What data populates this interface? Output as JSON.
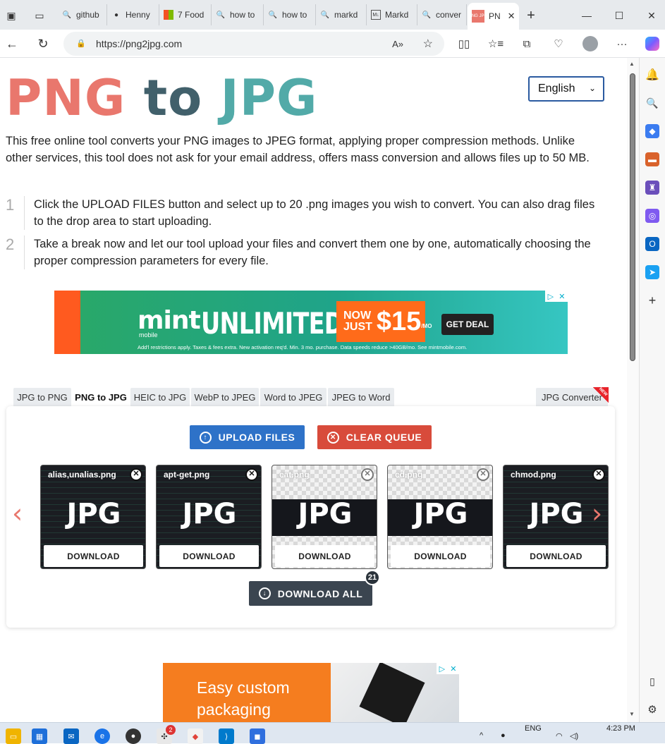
{
  "browser": {
    "tabs": [
      {
        "label": "github",
        "icon": "search-icon"
      },
      {
        "label": "Henny",
        "icon": "github-icon"
      },
      {
        "label": "7 Food",
        "icon": "microsoft-icon"
      },
      {
        "label": "how to",
        "icon": "search-icon"
      },
      {
        "label": "how to",
        "icon": "search-icon"
      },
      {
        "label": "markd",
        "icon": "search-icon"
      },
      {
        "label": "Markd",
        "icon": "markdown-icon"
      },
      {
        "label": "conver",
        "icon": "search-icon"
      },
      {
        "label": "PN",
        "icon": "png2jpg-favicon",
        "active": true
      }
    ],
    "active_tab_favicon_text": "PNG JPG",
    "url": "https://png2jpg.com",
    "colors": {
      "tabbar": "#e7eaed",
      "accent": "#1a73e8"
    }
  },
  "page": {
    "logo": {
      "part1": "PNG",
      "part2": "to",
      "part3": "JPG"
    },
    "language": "English",
    "intro": "This free online tool converts your PNG images to JPEG format, applying proper compression methods. Unlike other services, this tool does not ask for your email address, offers mass conversion and allows files up to 50 MB.",
    "steps": [
      {
        "num": "1",
        "text": "Click the UPLOAD FILES button and select up to 20 .png images you wish to convert. You can also drag files to the drop area to start uploading."
      },
      {
        "num": "2",
        "text": "Take a break now and let our tool upload your files and convert them one by one, automatically choosing the proper compression parameters for every file."
      }
    ],
    "ad1": {
      "brand": "mint",
      "brand_sub": "mobile",
      "headline": "UNLIMITED",
      "price_lead1": "NOW",
      "price_lead2": "JUST",
      "price": "$15",
      "price_suffix": "/MO",
      "cta": "GET DEAL",
      "fine_print": "Add'l restrictions apply. Taxes & fees extra. New activation req'd. Min. 3 mo. purchase. Data speeds reduce >40GB/mo. See mintmobile.com."
    },
    "converter_tabs": [
      {
        "label": "JPG to PNG"
      },
      {
        "label": "PNG to JPG",
        "active": true
      },
      {
        "label": "HEIC to JPG"
      },
      {
        "label": "WebP to JPEG"
      },
      {
        "label": "Word to JPEG"
      },
      {
        "label": "JPEG to Word"
      }
    ],
    "converter_tab_right": {
      "label": "JPG Converter",
      "flag": "NEW"
    },
    "upload_label": "UPLOAD FILES",
    "clear_label": "CLEAR QUEUE",
    "files": [
      {
        "name": "alias,unalias.png",
        "format": "JPG",
        "download": "DOWNLOAD"
      },
      {
        "name": "apt-get.png",
        "format": "JPG",
        "download": "DOWNLOAD"
      },
      {
        "name": "cat.png",
        "format": "JPG",
        "download": "DOWNLOAD"
      },
      {
        "name": "cd.png",
        "format": "JPG",
        "download": "DOWNLOAD"
      },
      {
        "name": "chmod.png",
        "format": "JPG",
        "download": "DOWNLOAD"
      }
    ],
    "download_all_label": "DOWNLOAD ALL",
    "download_all_count": "21",
    "ad2": {
      "line1": "Easy custom",
      "line2": "packaging"
    },
    "colors": {
      "logo_png": "#e9776d",
      "logo_to": "#41606b",
      "logo_jpg": "#52aaa8",
      "upload": "#2e72c8",
      "clear": "#d84b3b",
      "download_all": "#3b4550"
    }
  },
  "taskbar": {
    "language": "ENG",
    "time": "4:23 PM",
    "notification_count": "2"
  }
}
